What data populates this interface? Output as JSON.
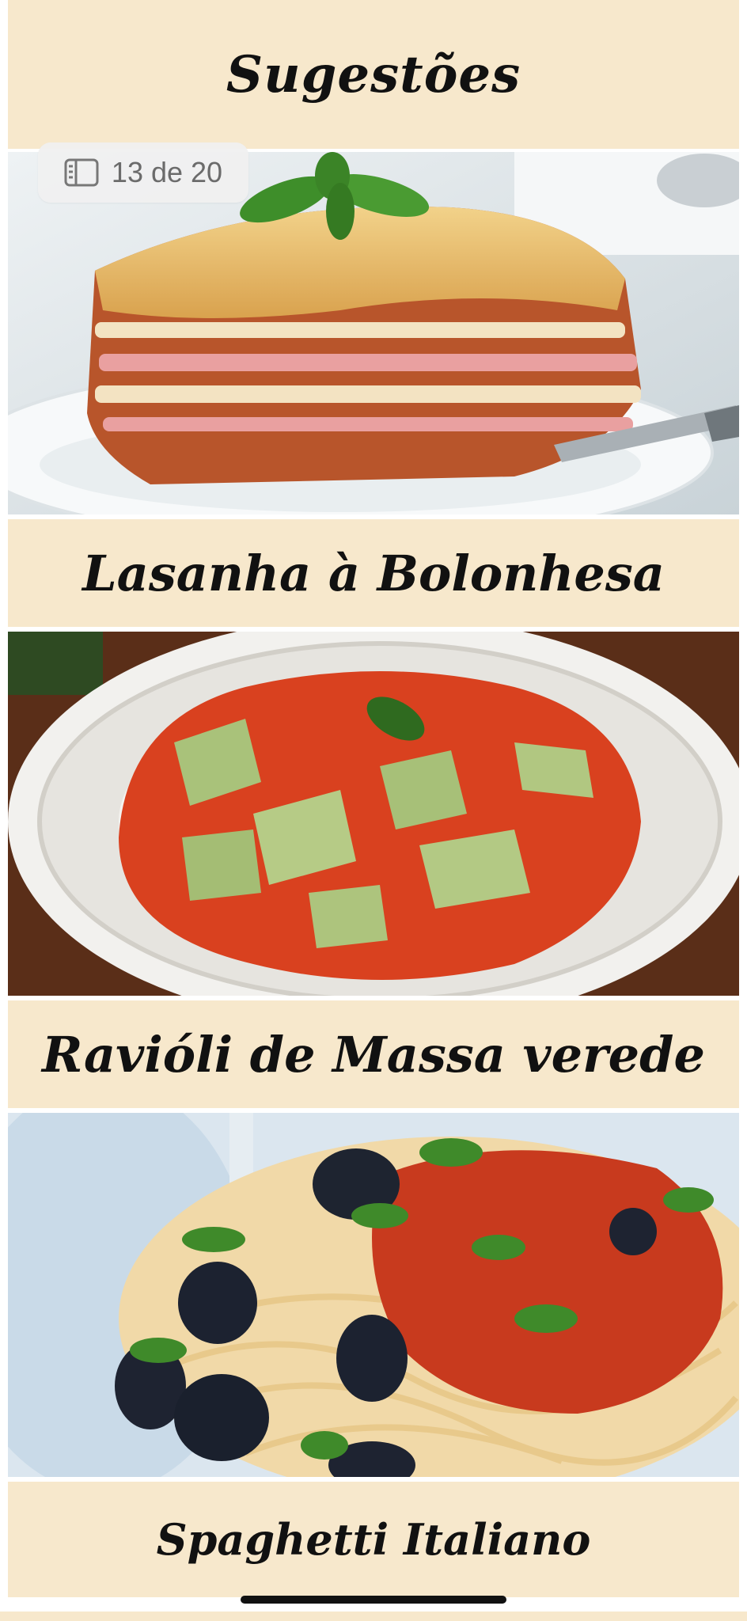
{
  "header": {
    "title": "Sugestões"
  },
  "counter": {
    "text": "13 de 20",
    "icon": "list-icon"
  },
  "suggestions": [
    {
      "title": "Lasanha à Bolonhesa",
      "photo": "lasagna-photo"
    },
    {
      "title": "Ravióli de Massa verede",
      "photo": "ravioli-photo"
    },
    {
      "title": "Spaghetti Italiano",
      "photo": "spaghetti-photo"
    }
  ],
  "colors": {
    "title_background": "#F7E8CC",
    "title_text": "#111111",
    "badge_background": "#F0F0F0",
    "badge_text": "#6B6B6B"
  }
}
